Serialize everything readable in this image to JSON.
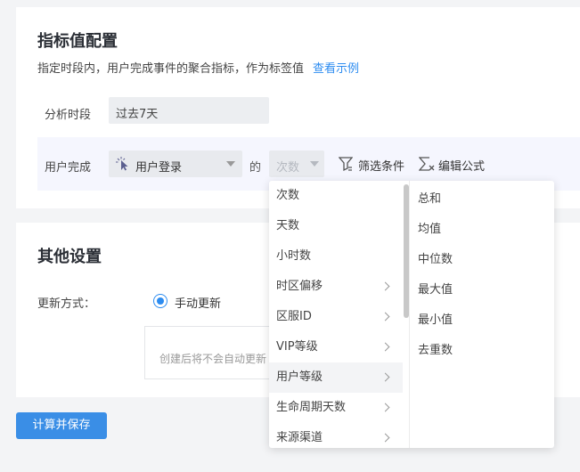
{
  "config_section": {
    "title": "指标值配置",
    "description": "指定时段内，用户完成事件的聚合指标，作为标签值",
    "example_link": "查看示例",
    "period_label": "分析时段",
    "period_value": "过去7天",
    "event_row": {
      "label": "用户完成",
      "event_value": "用户登录",
      "connector": "的",
      "metric_placeholder": "次数",
      "filter_label": "筛选条件",
      "formula_label": "编辑公式"
    }
  },
  "other_section": {
    "title": "其他设置",
    "update_label": "更新方式：",
    "update_option": "手动更新",
    "note": "创建后将不会自动更新"
  },
  "save_button": "计算并保存",
  "dropdown": {
    "left_options": [
      {
        "label": "次数",
        "has_children": false
      },
      {
        "label": "天数",
        "has_children": false
      },
      {
        "label": "小时数",
        "has_children": false
      },
      {
        "label": "时区偏移",
        "has_children": true
      },
      {
        "label": "区服ID",
        "has_children": true
      },
      {
        "label": "VIP等级",
        "has_children": true
      },
      {
        "label": "用户等级",
        "has_children": true
      },
      {
        "label": "生命周期天数",
        "has_children": true
      },
      {
        "label": "来源渠道",
        "has_children": true
      }
    ],
    "right_options": [
      {
        "label": "总和"
      },
      {
        "label": "均值"
      },
      {
        "label": "中位数"
      },
      {
        "label": "最大值"
      },
      {
        "label": "最小值"
      },
      {
        "label": "去重数"
      }
    ],
    "hovered_index": 6
  },
  "colors": {
    "accent": "#2d8cf0",
    "save_button": "#3a8ee6",
    "event_row_bg": "#f5f6fe"
  }
}
